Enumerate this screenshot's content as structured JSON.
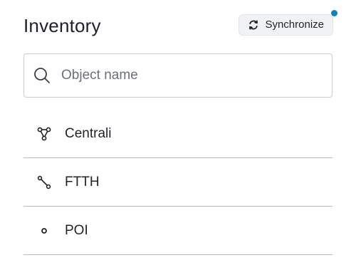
{
  "header": {
    "title": "Inventory",
    "sync_button_label": "Synchronize",
    "sync_icon": "sync-icon",
    "notification_dot_color": "#0b84b8"
  },
  "search": {
    "placeholder": "Object name",
    "value": "",
    "icon": "search-icon"
  },
  "list": {
    "items": [
      {
        "label": "Centrali",
        "icon": "network-graph-icon"
      },
      {
        "label": "FTTH",
        "icon": "connection-line-icon"
      },
      {
        "label": "POI",
        "icon": "point-icon"
      }
    ]
  }
}
